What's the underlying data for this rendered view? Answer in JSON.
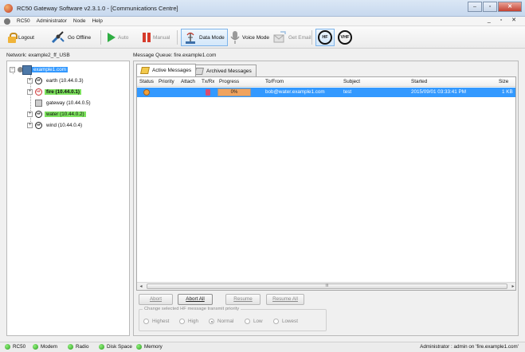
{
  "window": {
    "title": "RC50 Gateway Software v2.3.1.0 - [Communications Centre]"
  },
  "menu": {
    "items": [
      "RC50",
      "Administrator",
      "Node",
      "Help"
    ],
    "mdi_controls": "_ ▫ ✕"
  },
  "toolbar": {
    "logout": "Logout",
    "go_offline": "Go Offline",
    "auto": "Auto",
    "manual": "Manual",
    "data_mode": "Data Mode",
    "voice_mode": "Voice Mode",
    "get_email": "Get Email",
    "hf": "HF",
    "vhf": "VHF"
  },
  "network": {
    "label": "Network: example2_ff_USB",
    "nodes": {
      "root": "example1.com",
      "earth": "earth (10.44.0.3)",
      "fire": "fire (10.44.0.1)",
      "gateway": "gateway (10.44.0.5)",
      "water": "water (10.44.0.2)",
      "wind": "wind (10.44.0.4)"
    }
  },
  "queue": {
    "label": "Message Queue: fire.example1.com",
    "tabs": [
      "Active Messages",
      "Archived Messages"
    ],
    "columns": [
      "Status",
      "Priority",
      "Attach",
      "Tx/Rx",
      "Progress",
      "To/From",
      "Subject",
      "Started",
      "Size"
    ],
    "row": {
      "progress": "0%",
      "progress_fraction": 0.0,
      "to_from": "bob@water.example1.com",
      "subject": "test",
      "started": "2015/09/01 03:33:41 PM",
      "size": "1 KB"
    },
    "scroll_thumb": "III"
  },
  "actions": {
    "abort": "Abort",
    "abort_all": "Abort All",
    "resume": "Resume",
    "resume_all": "Resume All",
    "priority_legend": "Change selected HF message transmit priority",
    "priorities": [
      "Highest",
      "High",
      "Normal",
      "Low",
      "Lowest"
    ],
    "selected_priority": "Normal"
  },
  "statusbar": {
    "items": [
      "RC50",
      "Modem",
      "Radio",
      "Disk Space",
      "Memory"
    ],
    "right": "Administrator : admin  on 'fire.example1.com'"
  }
}
